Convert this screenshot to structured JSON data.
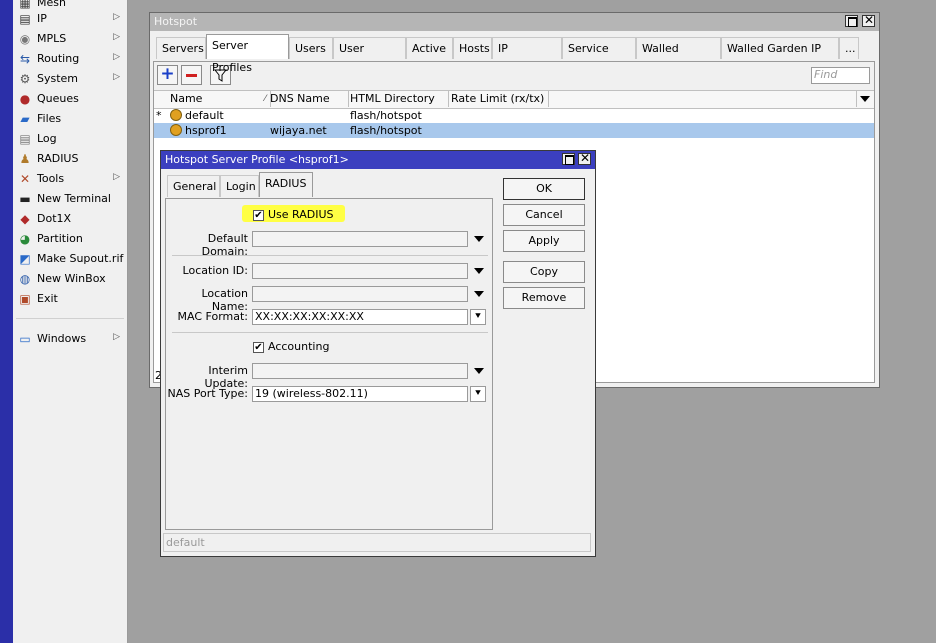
{
  "sidebar": {
    "items": [
      {
        "label": "Mesh",
        "icon": "mesh-icon",
        "arrow": false
      },
      {
        "label": "IP",
        "icon": "ip-icon",
        "arrow": true
      },
      {
        "label": "MPLS",
        "icon": "mpls-icon",
        "arrow": true
      },
      {
        "label": "Routing",
        "icon": "routing-icon",
        "arrow": true
      },
      {
        "label": "System",
        "icon": "system-icon",
        "arrow": true
      },
      {
        "label": "Queues",
        "icon": "queues-icon",
        "arrow": false
      },
      {
        "label": "Files",
        "icon": "files-icon",
        "arrow": false
      },
      {
        "label": "Log",
        "icon": "log-icon",
        "arrow": false
      },
      {
        "label": "RADIUS",
        "icon": "radius-icon",
        "arrow": false
      },
      {
        "label": "Tools",
        "icon": "tools-icon",
        "arrow": true
      },
      {
        "label": "New Terminal",
        "icon": "terminal-icon",
        "arrow": false
      },
      {
        "label": "Dot1X",
        "icon": "dot1x-icon",
        "arrow": false
      },
      {
        "label": "Partition",
        "icon": "partition-icon",
        "arrow": false
      },
      {
        "label": "Make Supout.rif",
        "icon": "supout-icon",
        "arrow": false
      },
      {
        "label": "New WinBox",
        "icon": "winbox-icon",
        "arrow": false
      },
      {
        "label": "Exit",
        "icon": "exit-icon",
        "arrow": false
      },
      {
        "label": "Windows",
        "icon": "windows-icon",
        "arrow": true
      }
    ]
  },
  "hotspot": {
    "title": "Hotspot",
    "tabs": [
      "Servers",
      "Server Profiles",
      "Users",
      "User Profiles",
      "Active",
      "Hosts",
      "IP Bindings",
      "Service Ports",
      "Walled Garden",
      "Walled Garden IP List",
      "..."
    ],
    "active_tab": "Server Profiles",
    "find_placeholder": "Find",
    "columns": [
      "Name",
      "DNS Name",
      "HTML Directory",
      "Rate Limit (rx/tx)"
    ],
    "rows": [
      {
        "marker": "*",
        "name": "default",
        "dns": "",
        "dir": "flash/hotspot",
        "rate": "",
        "selected": false
      },
      {
        "marker": "",
        "name": "hsprof1",
        "dns": "wijaya.net",
        "dir": "flash/hotspot",
        "rate": "",
        "selected": true
      }
    ],
    "status_fragment": "2"
  },
  "dialog": {
    "title": "Hotspot Server Profile <hsprof1>",
    "tabs": [
      "General",
      "Login",
      "RADIUS"
    ],
    "active_tab": "RADIUS",
    "use_radius_label": "Use RADIUS",
    "use_radius_checked": true,
    "default_domain_label": "Default Domain:",
    "default_domain_value": "",
    "location_id_label": "Location ID:",
    "location_id_value": "",
    "location_name_label": "Location Name:",
    "location_name_value": "",
    "mac_format_label": "MAC Format:",
    "mac_format_value": "XX:XX:XX:XX:XX:XX",
    "accounting_label": "Accounting",
    "accounting_checked": true,
    "interim_update_label": "Interim Update:",
    "interim_update_value": "",
    "nas_port_type_label": "NAS Port Type:",
    "nas_port_type_value": "19 (wireless-802.11)",
    "buttons": {
      "ok": "OK",
      "cancel": "Cancel",
      "apply": "Apply",
      "copy": "Copy",
      "remove": "Remove"
    },
    "status": "default"
  },
  "colors": {
    "hotspot_title_active": false,
    "dialog_title_bg": "#3b3fbf",
    "highlight": "#ffff44",
    "selected_row": "#a8c8ec"
  }
}
